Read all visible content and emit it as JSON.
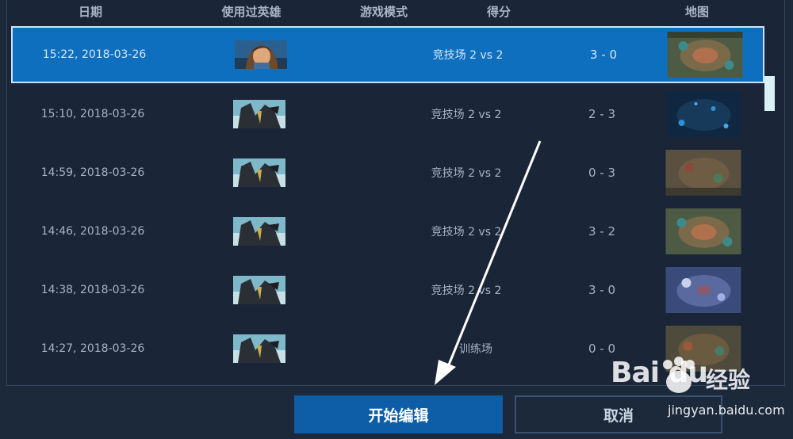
{
  "columns": {
    "date": "日期",
    "hero": "使用过英雄",
    "mode": "游戏模式",
    "score": "得分",
    "map": "地图"
  },
  "rows": [
    {
      "date": "15:22, 2018-03-26",
      "mode": "竞技场 2 vs 2",
      "score": "3 - 0",
      "selected": true
    },
    {
      "date": "15:10, 2018-03-26",
      "mode": "竞技场 2 vs 2",
      "score": "2 - 3",
      "selected": false
    },
    {
      "date": "14:59, 2018-03-26",
      "mode": "竞技场 2 vs 2",
      "score": "0 - 3",
      "selected": false
    },
    {
      "date": "14:46, 2018-03-26",
      "mode": "竞技场 2 vs 2",
      "score": "3 - 2",
      "selected": false
    },
    {
      "date": "14:38, 2018-03-26",
      "mode": "竞技场 2 vs 2",
      "score": "3 - 0",
      "selected": false
    },
    {
      "date": "14:27, 2018-03-26",
      "mode": "训练场",
      "score": "0 - 0",
      "selected": false
    }
  ],
  "buttons": {
    "start_edit": "开始编辑",
    "cancel": "取消"
  },
  "watermark": {
    "brand": "Bai du",
    "cn": "经验",
    "url": "jingyan.baidu.com"
  },
  "colors": {
    "selected_row": "#0f6fbf",
    "primary_button": "#0d5ea6",
    "background": "#1c293a"
  }
}
